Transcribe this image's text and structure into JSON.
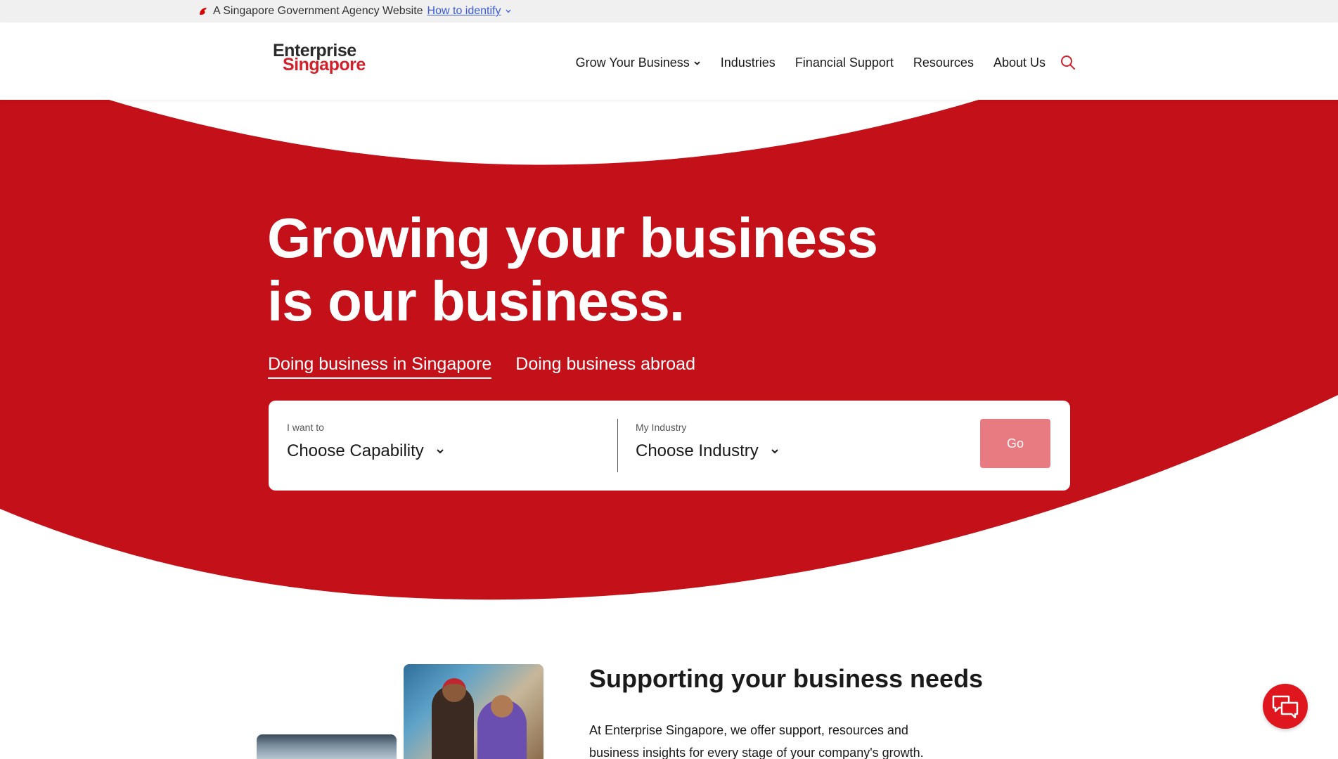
{
  "masthead": {
    "text": "A Singapore Government Agency Website",
    "link": "How to identify"
  },
  "logo": {
    "line1": "Enterprise",
    "line2": "Singapore"
  },
  "nav": {
    "items": [
      {
        "label": "Grow Your Business",
        "has_dropdown": true
      },
      {
        "label": "Industries"
      },
      {
        "label": "Financial Support"
      },
      {
        "label": "Resources"
      },
      {
        "label": "About Us"
      }
    ],
    "search_icon": "search-icon"
  },
  "hero": {
    "title_line1": "Growing your business",
    "title_line2": "is our business.",
    "tabs": [
      {
        "label": "Doing business in Singapore",
        "active": true
      },
      {
        "label": "Doing business abroad",
        "active": false
      }
    ],
    "finder": {
      "capability_label": "I want to",
      "capability_value": "Choose Capability",
      "industry_label": "My Industry",
      "industry_value": "Choose Industry",
      "go_label": "Go"
    }
  },
  "support": {
    "title": "Supporting your business needs",
    "body": "At Enterprise Singapore, we offer support, resources and business insights for every stage of your company's growth."
  },
  "colors": {
    "brand_red": "#c41018",
    "go_button": "#e87a82",
    "chat_button": "#e0161e"
  },
  "chat_icon": "chat-bubbles-icon"
}
